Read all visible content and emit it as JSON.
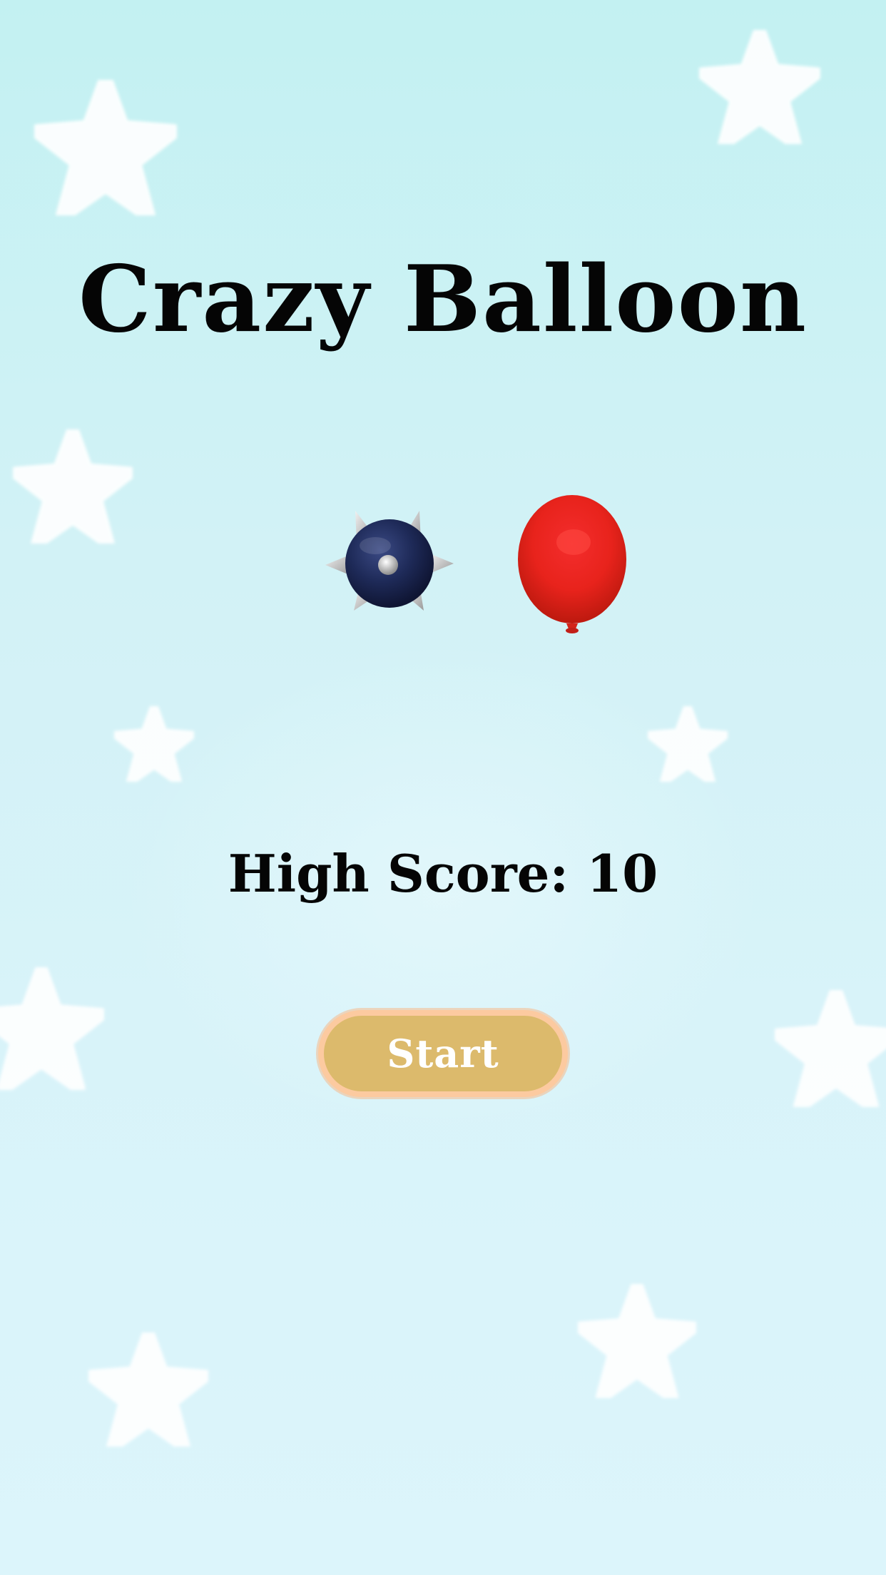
{
  "app": {
    "title": "Crazy Balloon"
  },
  "hero": {
    "mine_icon": "spiked-mine-icon",
    "balloon_icon": "red-balloon-icon"
  },
  "score": {
    "label": "High Score:",
    "value": "10",
    "text": "High Score: 10"
  },
  "actions": {
    "start_label": "Start"
  },
  "colors": {
    "background_top": "#c3f1f2",
    "background_bottom": "#dcf5fb",
    "button_fill": "#dcba6c",
    "button_border": "#fccaa0",
    "balloon": "#e8231c",
    "mine": "#1e2a55",
    "text": "#050505"
  }
}
